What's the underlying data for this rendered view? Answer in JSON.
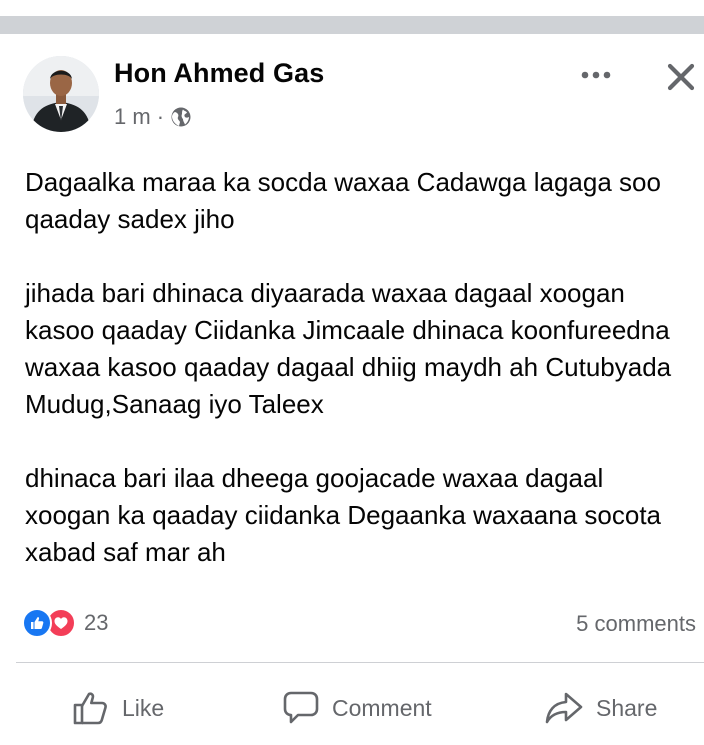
{
  "post": {
    "author": "Hon Ahmed Gas",
    "time": "1 m",
    "separator": "·",
    "privacy_icon": "globe-icon",
    "more_icon": "more-options-icon",
    "close_icon": "close-icon",
    "paragraphs": [
      "Dagaalka maraa ka socda waxaa Cadawga lagaga soo qaaday sadex jiho",
      "jihada bari dhinaca diyaarada waxaa dagaal xoogan kasoo qaaday Ciidanka Jimcaale dhinaca koonfureedna waxaa kasoo qaaday dagaal dhiig maydh ah Cutubyada Mudug,Sanaag iyo Taleex",
      "dhinaca bari ilaa dheega goojacade waxaa dagaal xoogan ka qaaday ciidanka Degaanka waxaana socota xabad saf mar ah"
    ]
  },
  "engagement": {
    "reaction_icons": [
      "like-reaction-icon",
      "love-reaction-icon"
    ],
    "reaction_count": "23",
    "comments": "5 comments"
  },
  "actions": {
    "like": "Like",
    "comment": "Comment",
    "share": "Share"
  },
  "colors": {
    "like_blue": "#1877f2",
    "love_red": "#f33e58",
    "secondary_text": "#65676b",
    "primary_text": "#050505"
  }
}
